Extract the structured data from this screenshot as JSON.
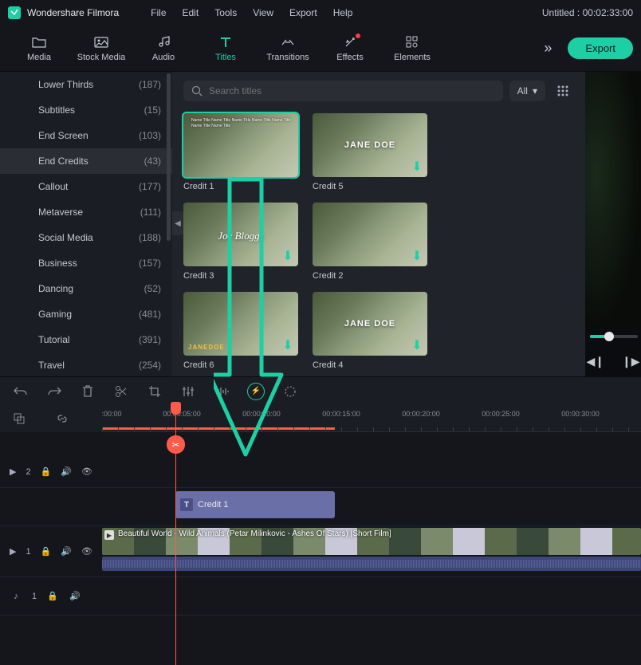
{
  "app": {
    "name": "Wondershare Filmora"
  },
  "menu": {
    "file": "File",
    "edit": "Edit",
    "tools": "Tools",
    "view": "View",
    "export": "Export",
    "help": "Help"
  },
  "project": {
    "title": "Untitled",
    "duration": "00:02:33:00"
  },
  "tabs": {
    "media": "Media",
    "stockMedia": "Stock Media",
    "audio": "Audio",
    "titles": "Titles",
    "transitions": "Transitions",
    "effects": "Effects",
    "elements": "Elements"
  },
  "exportBtn": "Export",
  "search": {
    "placeholder": "Search titles",
    "filter": "All"
  },
  "categories": [
    {
      "name": "Lower Thirds",
      "count": "(187)"
    },
    {
      "name": "Subtitles",
      "count": "(15)"
    },
    {
      "name": "End Screen",
      "count": "(103)"
    },
    {
      "name": "End Credits",
      "count": "(43)"
    },
    {
      "name": "Callout",
      "count": "(177)"
    },
    {
      "name": "Metaverse",
      "count": "(111)"
    },
    {
      "name": "Social Media",
      "count": "(188)"
    },
    {
      "name": "Business",
      "count": "(157)"
    },
    {
      "name": "Dancing",
      "count": "(52)"
    },
    {
      "name": "Gaming",
      "count": "(481)"
    },
    {
      "name": "Tutorial",
      "count": "(391)"
    },
    {
      "name": "Travel",
      "count": "(254)"
    }
  ],
  "thumbs": {
    "t1": {
      "label": "Credit 1",
      "overlay": "Name Title\nName Title\nName Title\nName Title\nName Title\nName Title\nName Title"
    },
    "t2": {
      "label": "Credit 5",
      "overlay": "JANE DOE"
    },
    "t3": {
      "label": "Credit 3",
      "overlay": "Joe Bloggs"
    },
    "t4": {
      "label": "Credit 2"
    },
    "t5": {
      "label": "Credit 6",
      "overlay": "JANEDOE"
    },
    "t6": {
      "label": "Credit 4",
      "overlay": "JANE DOE"
    }
  },
  "ruler": {
    "ticks": [
      ":00:00",
      "00:00:05:00",
      "00:00:10:00",
      "00:00:15:00",
      "00:00:20:00",
      "00:00:25:00",
      "00:00:30:00"
    ]
  },
  "tracks": {
    "title": {
      "id": "T",
      "num": "2",
      "clipLabel": "Credit 1",
      "badge": "T"
    },
    "video": {
      "id": "V",
      "num": "1",
      "clipLabel": "Beautiful World - Wild Animals (Petar Milinkovic - Ashes Of Stars)  [Short Film]"
    },
    "audio": {
      "id": "A",
      "num": "1"
    }
  }
}
